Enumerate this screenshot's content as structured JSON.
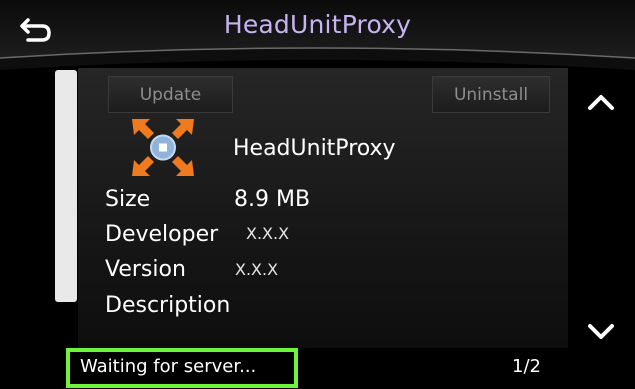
{
  "header": {
    "title": "HeadUnitProxy",
    "back_icon": "back-arrow-icon"
  },
  "buttons": {
    "update": "Update",
    "uninstall": "Uninstall"
  },
  "app": {
    "name": "HeadUnitProxy",
    "icon": "app-expand-icon"
  },
  "details": {
    "size_label": "Size",
    "size_value": "8.9 MB",
    "developer_label": "Developer",
    "developer_value": "X.X.X",
    "version_label": "Version",
    "version_value": "X.X.X",
    "description_label": "Description"
  },
  "scroll": {
    "up_icon": "chevron-up-icon",
    "down_icon": "chevron-down-icon"
  },
  "status": {
    "text": "Waiting for server...",
    "page": "1/2"
  },
  "colors": {
    "title": "#c6b4f2",
    "highlight": "#6ef43c",
    "icon_orange": "#f07a1e",
    "icon_blue": "#8fb3d9"
  }
}
